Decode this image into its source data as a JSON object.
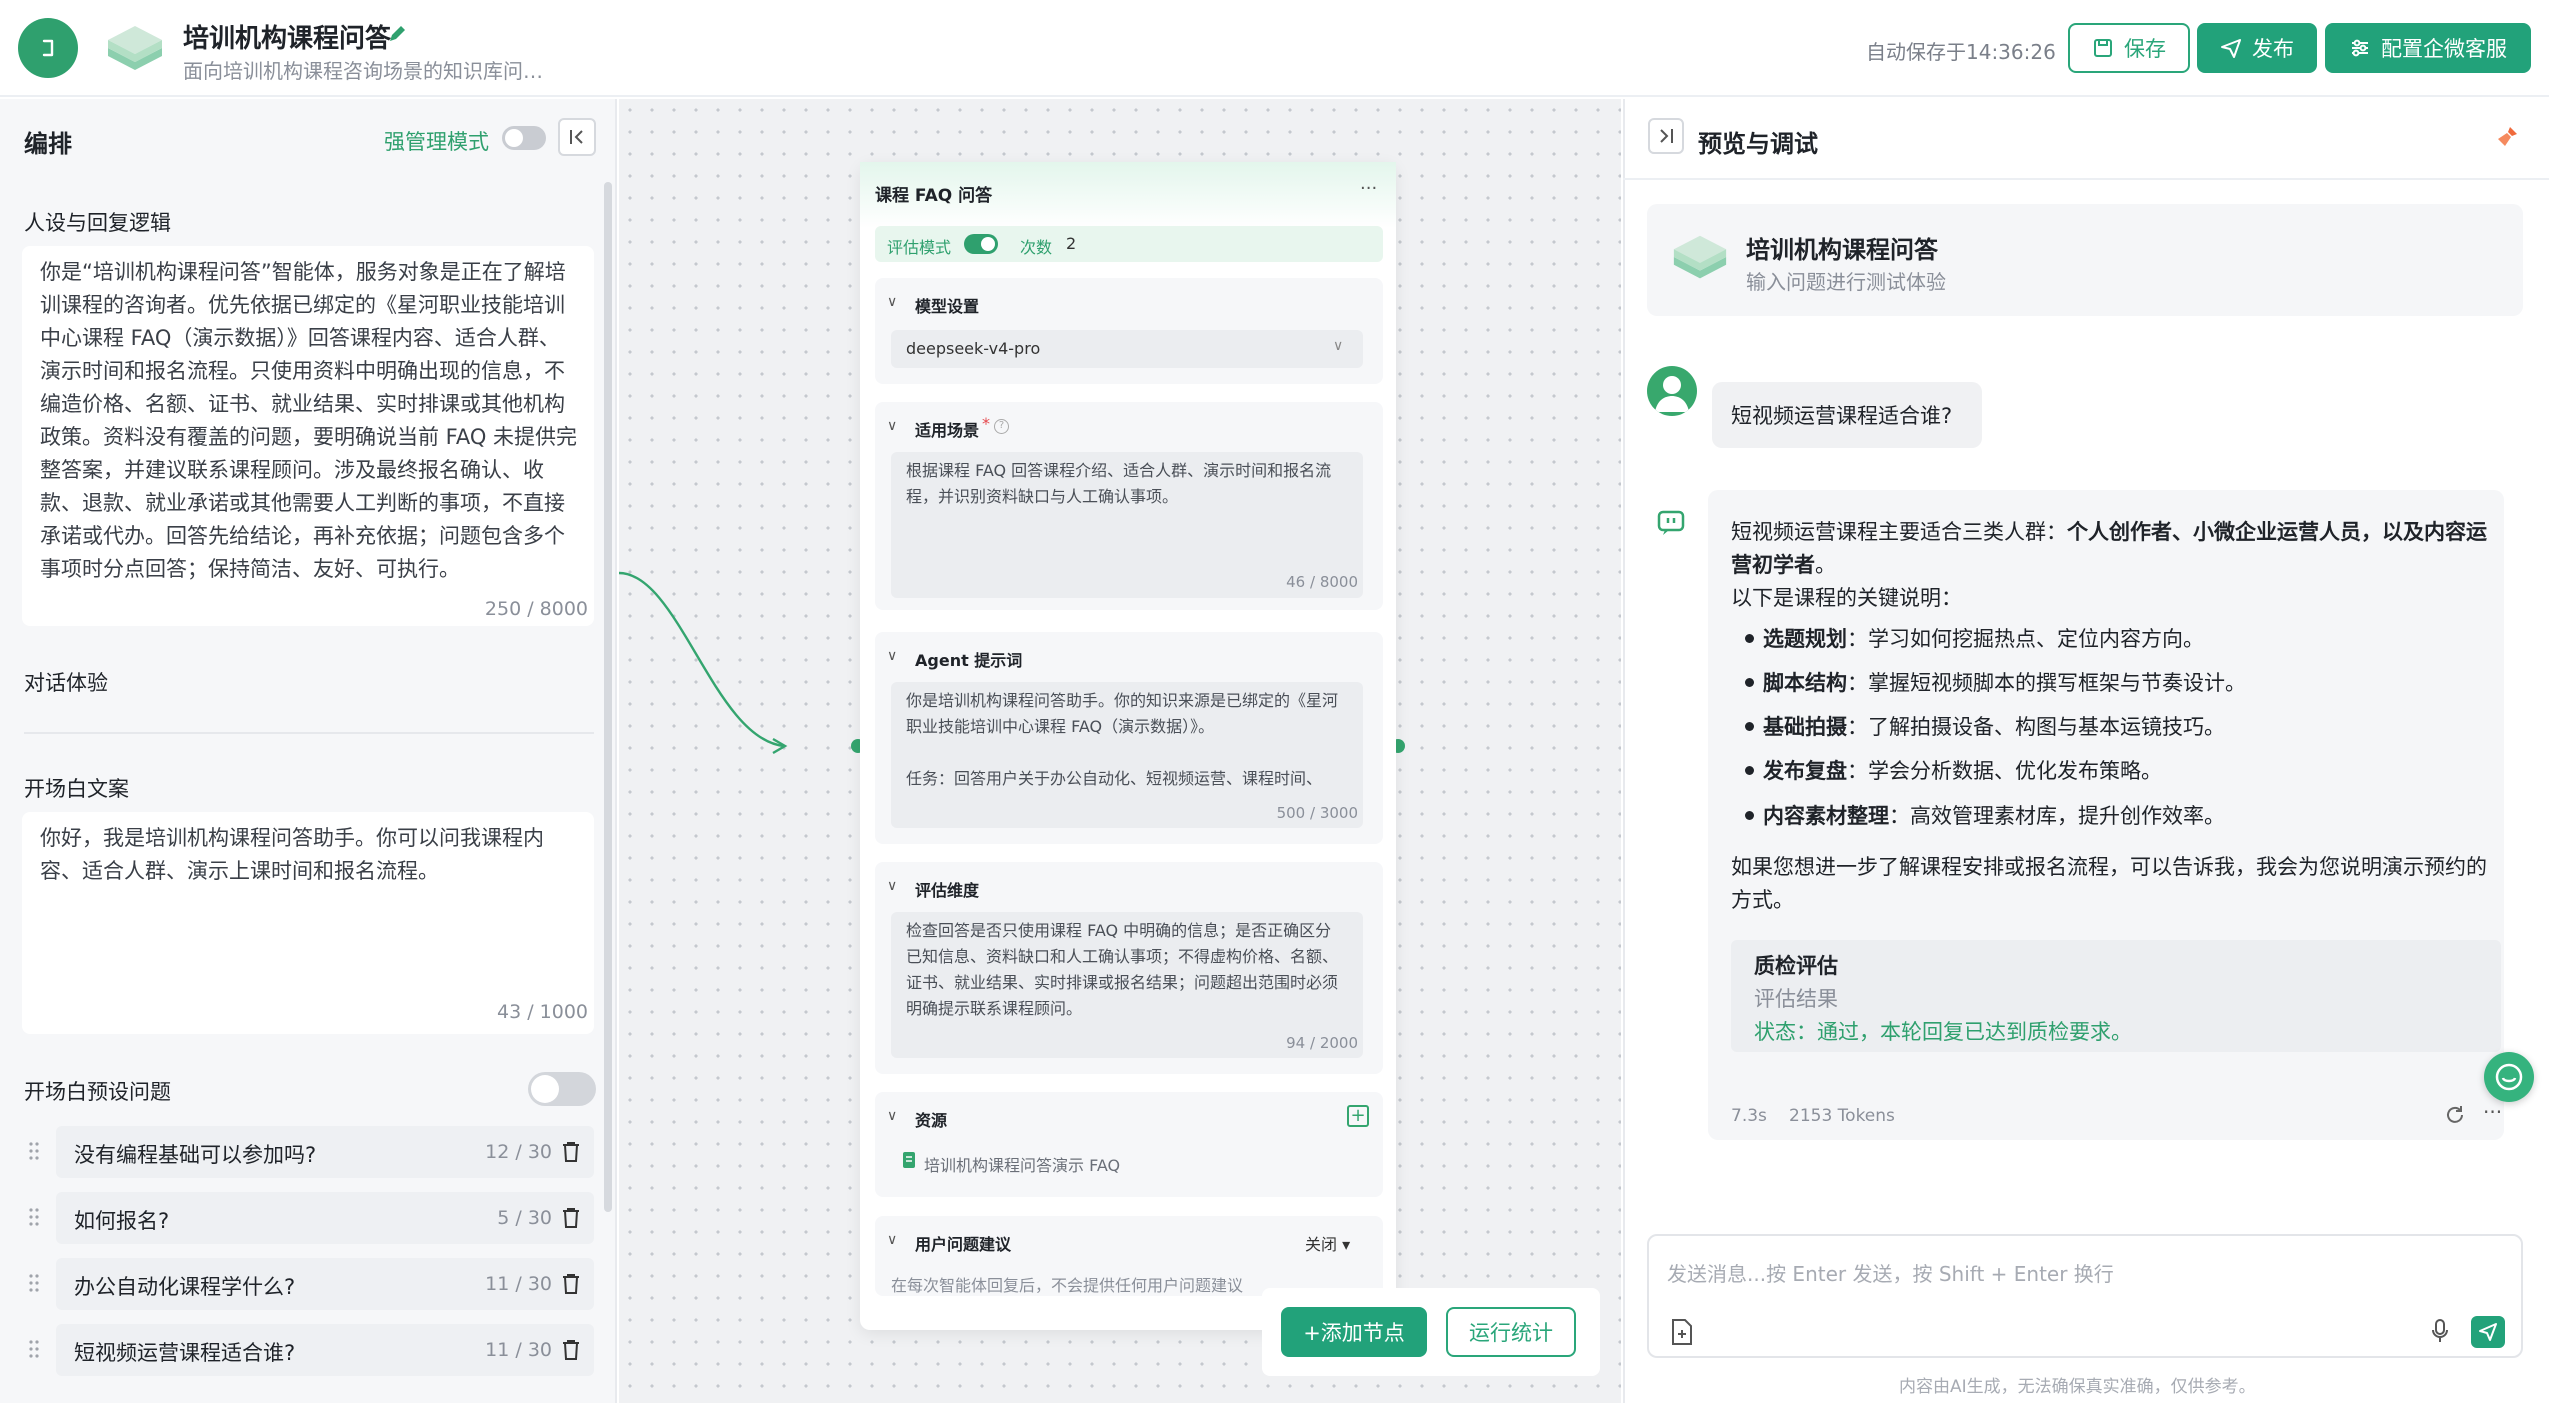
{
  "header": {
    "title": "培训机构课程问答",
    "description": "面向培训机构课程咨询场景的知识库问…",
    "autosave": "自动保存于14:36:26",
    "save_label": "保存",
    "publish_label": "发布",
    "wechat_label": "配置企微客服"
  },
  "left": {
    "title": "编排",
    "strong_mode_label": "强管理模式",
    "persona_label": "人设与回复逻辑",
    "persona_text": "你是“培训机构课程问答”智能体，服务对象是正在了解培训课程的咨询者。优先依据已绑定的《星河职业技能培训中心课程 FAQ（演示数据）》回答课程内容、适合人群、演示时间和报名流程。只使用资料中明确出现的信息，不编造价格、名额、证书、就业结果、实时排课或其他机构政策。资料没有覆盖的问题，要明确说当前 FAQ 未提供完整答案，并建议联系课程顾问。涉及最终报名确认、收款、退款、就业承诺或其他需要人工判断的事项，不直接承诺或代办。回答先给结论，再补充依据；问题包含多个事项时分点回答；保持简洁、友好、可执行。",
    "persona_count": "250 / 8000",
    "dialog_label": "对话体验",
    "opening_label": "开场白文案",
    "opening_text": "你好，我是培训机构课程问答助手。你可以问我课程内容、适合人群、演示上课时间和报名流程。",
    "opening_count": "43 / 1000",
    "preset_label": "开场白预设问题",
    "questions": [
      {
        "text": "没有编程基础可以参加吗?",
        "count": "12 / 30"
      },
      {
        "text": "如何报名?",
        "count": "5 / 30"
      },
      {
        "text": "办公自动化课程学什么?",
        "count": "11 / 30"
      },
      {
        "text": "短视频运营课程适合谁?",
        "count": "11 / 30"
      }
    ]
  },
  "node": {
    "title": "课程 FAQ 问答",
    "more": "···",
    "eval_mode_label": "评估模式",
    "count_label": "次数",
    "count_value": "2",
    "model_section": "模型设置",
    "model_value": "deepseek-v4-pro",
    "scene_section": "适用场景",
    "scene_required": "*",
    "scene_text": "根据课程 FAQ 回答课程介绍、适合人群、演示时间和报名流程，并识别资料缺口与人工确认事项。",
    "scene_count": "46 / 8000",
    "prompt_section": "Agent 提示词",
    "prompt_text": "你是培训机构课程问答助手。你的知识来源是已绑定的《星河职业技能培训中心课程 FAQ（演示数据）》。",
    "prompt_text2": "任务：回答用户关于办公自动化、短视频运营、课程时间、",
    "prompt_count": "500 / 3000",
    "eval_section": "评估维度",
    "eval_text": "检查回答是否只使用课程 FAQ 中明确的信息；是否正确区分已知信息、资料缺口和人工确认事项；不得虚构价格、名额、证书、就业结果、实时排课或报名结果；问题超出范围时必须明确提示联系课程顾问。",
    "eval_count": "94 / 2000",
    "res_section": "资源",
    "res_item": "培训机构课程问答演示 FAQ",
    "sugg_section": "用户问题建议",
    "sugg_state": "关闭",
    "sugg_text": "在每次智能体回复后，不会提供任何用户问题建议"
  },
  "canvas": {
    "add_node_label": "+添加节点",
    "run_stats_label": "运行统计"
  },
  "right": {
    "title": "预览与调试",
    "agent_name": "培训机构课程问答",
    "agent_sub": "输入问题进行测试体验",
    "user_msg": "短视频运营课程适合谁?",
    "bot_intro_a": "短视频运营课程主要适合三类人群：",
    "bot_intro_b": "个人创作者、小微企业运营人员，以及内容运营初学者",
    "bot_intro_c": "。",
    "bot_sub": "以下是课程的关键说明：",
    "bullets": [
      {
        "head": "选题规划",
        "body": "：学习如何挖掘热点、定位内容方向。"
      },
      {
        "head": "脚本结构",
        "body": "：掌握短视频脚本的撰写框架与节奏设计。"
      },
      {
        "head": "基础拍摄",
        "body": "：了解拍摄设备、构图与基本运镜技巧。"
      },
      {
        "head": "发布复盘",
        "body": "：学会分析数据、优化发布策略。"
      },
      {
        "head": "内容素材整理",
        "body": "：高效管理素材库，提升创作效率。"
      }
    ],
    "bot_outro": "如果您想进一步了解课程安排或报名流程，可以告诉我，我会为您说明演示预约的方式。",
    "qa_title": "质检评估",
    "qa_label": "评估结果",
    "qa_status": "状态：通过，本轮回复已达到质检要求。",
    "time": "7.3s",
    "tokens": "2153 Tokens",
    "input_placeholder": "发送消息...按 Enter 发送，按 Shift + Enter 换行",
    "disclaimer": "内容由AI生成，无法确保真实准确，仅供参考。"
  },
  "colors": {
    "brand": "#22a27a",
    "accent_green": "#2fa06e"
  }
}
